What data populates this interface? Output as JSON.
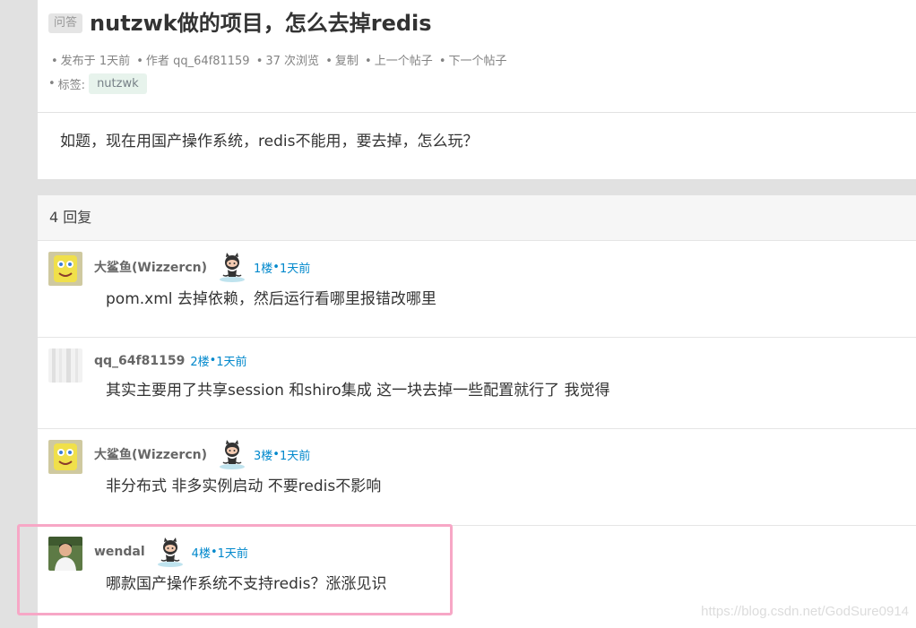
{
  "topic": {
    "tag": "问答",
    "title": "nutzwk做的项目，怎么去掉redis",
    "meta": {
      "published_label": "发布于",
      "published_time": "1天前",
      "author_label": "作者",
      "author": "qq_64f81159",
      "views": "37 次浏览",
      "copy": "复制",
      "prev": "上一个帖子",
      "next": "下一个帖子"
    },
    "tags_label": "标签:",
    "tags": [
      "nutzwk"
    ],
    "content": "如题，现在用国产操作系统，redis不能用，要去掉，怎么玩？"
  },
  "replies_header": "4 回复",
  "replies": [
    {
      "author": "大鲨鱼(Wizzercn)",
      "floor": "1楼",
      "time": "1天前",
      "content": "pom.xml 去掉依赖，然后运行看哪里报错改哪里",
      "has_icon": true
    },
    {
      "author": "qq_64f81159",
      "floor": "2楼",
      "time": "1天前",
      "content": "其实主要用了共享session 和shiro集成 这一块去掉一些配置就行了 我觉得",
      "has_icon": false
    },
    {
      "author": "大鲨鱼(Wizzercn)",
      "floor": "3楼",
      "time": "1天前",
      "content": "非分布式 非多实例启动 不要redis不影响",
      "has_icon": true
    },
    {
      "author": "wendal",
      "floor": "4楼",
      "time": "1天前",
      "content": "哪款国产操作系统不支持redis？涨涨见识",
      "has_icon": true
    }
  ],
  "watermark": "https://blog.csdn.net/GodSure0914",
  "colors": {
    "link": "#0088cc",
    "highlight": "#f7a7c6",
    "tag_bg": "#e7f3ec"
  }
}
